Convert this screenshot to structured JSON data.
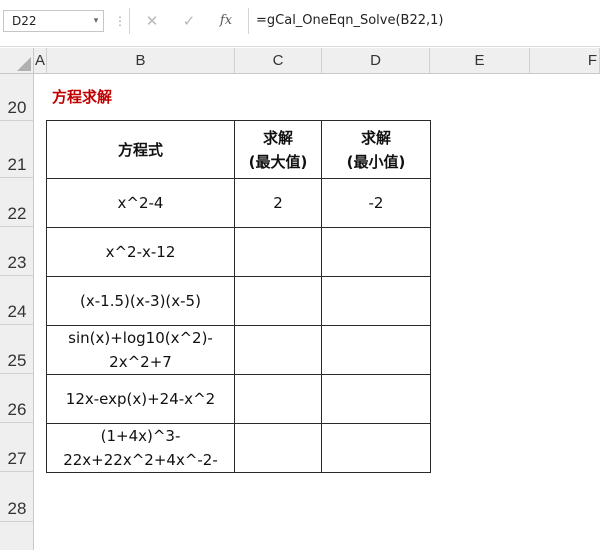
{
  "formula_bar": {
    "name_box": "D22",
    "name_box_arrow": "▾",
    "separator": "⋮",
    "cancel_glyph": "✕",
    "enter_glyph": "✓",
    "fx_label": "fx",
    "formula": "=gCal_OneEqn_Solve(B22,1)"
  },
  "columns": [
    "A",
    "B",
    "C",
    "D",
    "E",
    "F"
  ],
  "rows": [
    "20",
    "21",
    "22",
    "23",
    "24",
    "25",
    "26",
    "27",
    "28"
  ],
  "sheet": {
    "title": "方程求解",
    "table": {
      "headers": {
        "equation": "方程式",
        "max_line1": "求解",
        "max_line2": "(最大值)",
        "min_line1": "求解",
        "min_line2": "(最小值)"
      },
      "rows": [
        {
          "equation_line1": "x^2-4",
          "equation_line2": "",
          "max": "2",
          "min": "-2"
        },
        {
          "equation_line1": "x^2-x-12",
          "equation_line2": "",
          "max": "",
          "min": ""
        },
        {
          "equation_line1": "(x-1.5)(x-3)(x-5)",
          "equation_line2": "",
          "max": "",
          "min": ""
        },
        {
          "equation_line1": "sin(x)+log10(x^2)-",
          "equation_line2": "2x^2+7",
          "max": "",
          "min": ""
        },
        {
          "equation_line1": "12x-exp(x)+24-x^2",
          "equation_line2": "",
          "max": "",
          "min": ""
        },
        {
          "equation_line1": "(1+4x)^3-",
          "equation_line2": "22x+22x^2+4x^-2-",
          "max": "",
          "min": ""
        }
      ]
    }
  }
}
